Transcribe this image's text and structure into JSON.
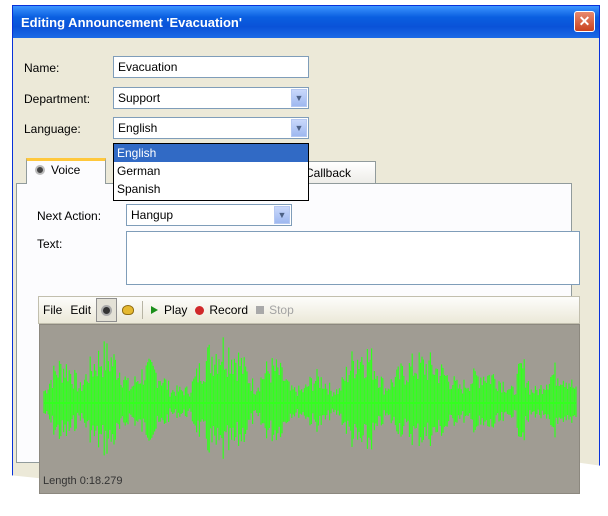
{
  "window": {
    "title": "Editing Announcement 'Evacuation'",
    "close_glyph": "✕"
  },
  "form": {
    "name_label": "Name:",
    "name_value": "Evacuation",
    "department_label": "Department:",
    "department_value": "Support",
    "language_label": "Language:",
    "language_value": "English",
    "language_options": [
      "English",
      "German",
      "Spanish"
    ]
  },
  "tabs": {
    "voice": "Voice",
    "callback": "Callback"
  },
  "voice": {
    "next_action_label": "Next Action:",
    "next_action_value": "Hangup",
    "text_label": "Text:",
    "text_value": ""
  },
  "toolbar": {
    "file": "File",
    "edit": "Edit",
    "play": "Play",
    "record": "Record",
    "stop": "Stop"
  },
  "waveform": {
    "length_text": "Length 0:18.279",
    "color": "#33ff1f",
    "background": "#a09c93"
  },
  "icons": {
    "combo_arrow": "▼"
  }
}
